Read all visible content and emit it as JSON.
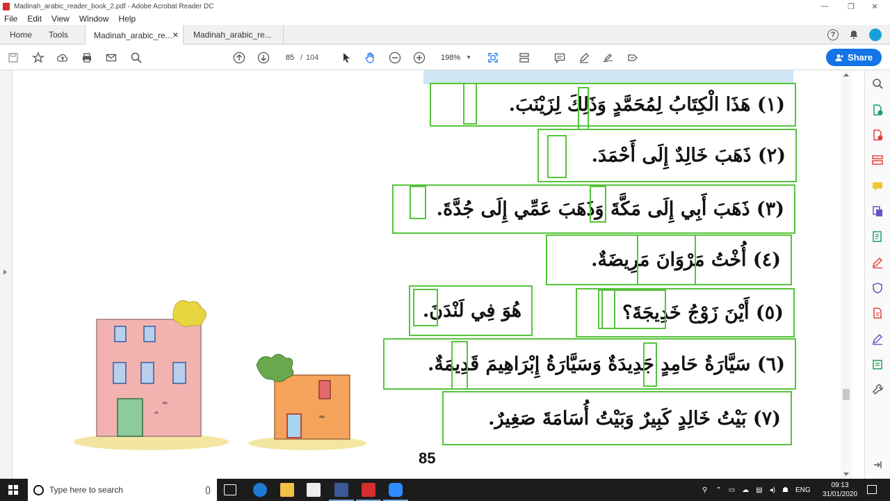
{
  "window": {
    "title": "Madinah_arabic_reader_book_2.pdf - Adobe Acrobat Reader DC",
    "minimize": "—",
    "maximize": "❐",
    "close": "✕"
  },
  "menu": [
    "File",
    "Edit",
    "View",
    "Window",
    "Help"
  ],
  "tabs": {
    "home": "Home",
    "tools": "Tools",
    "doc1": "Madinah_arabic_re...",
    "doc2": "Madinah_arabic_re...",
    "close_glyph": "✕"
  },
  "toolbar": {
    "current_page": "85",
    "page_sep": "/",
    "total_pages": "104",
    "zoom": "198%",
    "share_label": "Share"
  },
  "document": {
    "sentences": [
      "(١) هَذَا الْكِتَابُ لِمُحَمَّدٍ وَذَلِكَ لِزَيْنَبَ.",
      "(٢) ذَهَبَ خَالِدٌ إِلَى أَحْمَدَ.",
      "(٣) ذَهَبَ أَبِي إِلَى مَكَّةَ وَذَهَبَ عَمِّي إِلَى جُدَّةَ.",
      "(٤) أُخْتُ مَرْوَانَ مَرِيضَةٌ.",
      "(٥) أَيْنَ زَوْجُ خَدِيجَةَ؟",
      "هُوَ فِي لَنْدَنَ.",
      "(٦) سَيَّارَةُ حَامِدٍ جَدِيدَةٌ وَسَيَّارَةُ إِبْرَاهِيمَ قَدِيمَةٌ.",
      "(٧) بَيْتُ خَالِدٍ كَبِيرٌ وَبَيْتُ أُسَامَةَ صَغِيرٌ."
    ],
    "page_number": "85"
  },
  "taskbar": {
    "search_placeholder": "Type here to search",
    "language": "ENG",
    "time": "09:13",
    "date": "31/01/2020"
  },
  "colors": {
    "highlight_border": "#55c43a",
    "share_button": "#1473e6",
    "top_band": "#cfe6f5"
  }
}
